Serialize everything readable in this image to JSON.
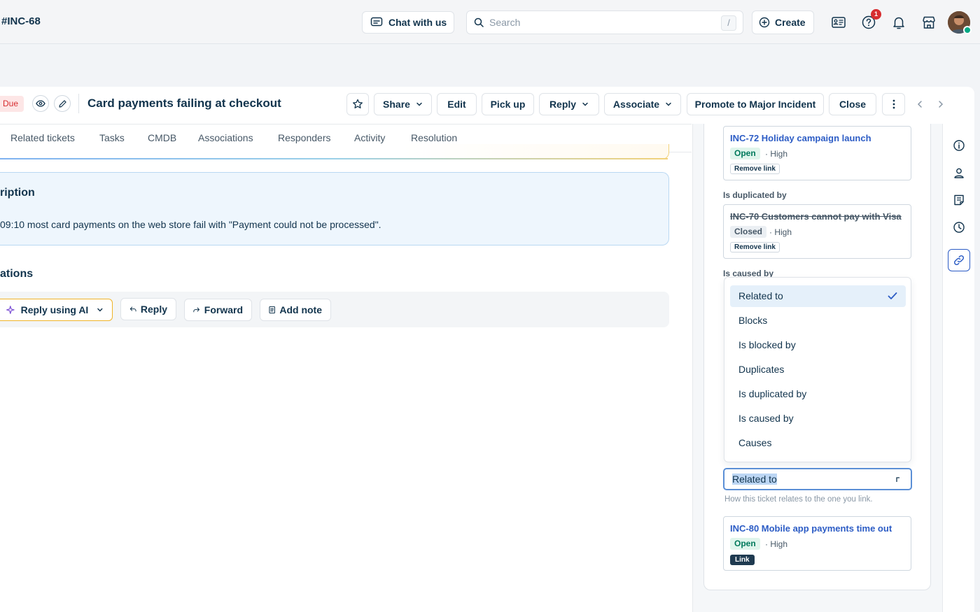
{
  "topbar": {
    "ticket_id": "#INC-68",
    "chat_label": "Chat with us",
    "search_placeholder": "Search",
    "search_shortcut": "/",
    "create_label": "Create",
    "help_badge_count": "1"
  },
  "header": {
    "due_label": "Due",
    "title": "Card payments failing at checkout",
    "buttons": {
      "share": "Share",
      "edit": "Edit",
      "pick_up": "Pick up",
      "reply": "Reply",
      "associate": "Associate",
      "promote": "Promote to Major Incident",
      "close": "Close"
    }
  },
  "tabs": [
    "Related tickets",
    "Tasks",
    "CMDB",
    "Associations",
    "Responders",
    "Activity",
    "Resolution"
  ],
  "description": {
    "heading": "ription",
    "text": "09:10 most card payments on the web store fail with \"Payment could not be processed\"."
  },
  "conversations": {
    "heading": "ations",
    "reply_ai": "Reply using AI",
    "reply": "Reply",
    "forward": "Forward",
    "add_note": "Add note"
  },
  "associations": {
    "card_top": {
      "link": "INC-72 Holiday campaign launch",
      "status": "Open",
      "priority": "· High",
      "action": "Remove link"
    },
    "label_duplicated": "Is duplicated by",
    "card_dup": {
      "link": "INC-70 Customers cannot pay with Visa",
      "status": "Closed",
      "priority": "· High",
      "action": "Remove link"
    },
    "label_caused": "Is caused by",
    "dropdown_options": [
      "Related to",
      "Blocks",
      "Is blocked by",
      "Duplicates",
      "Is duplicated by",
      "Is caused by",
      "Causes"
    ],
    "selected_option": "Related to",
    "select_value": "Related to",
    "hint": "How this ticket relates to the one you link.",
    "card_new": {
      "link": "INC-80 Mobile app payments time out",
      "status": "Open",
      "priority": "· High",
      "action": "Link"
    }
  },
  "colors": {
    "link": "#2c5cc5",
    "open": "#00795b",
    "danger": "#d72d30",
    "ai_border": "#f0b429"
  }
}
